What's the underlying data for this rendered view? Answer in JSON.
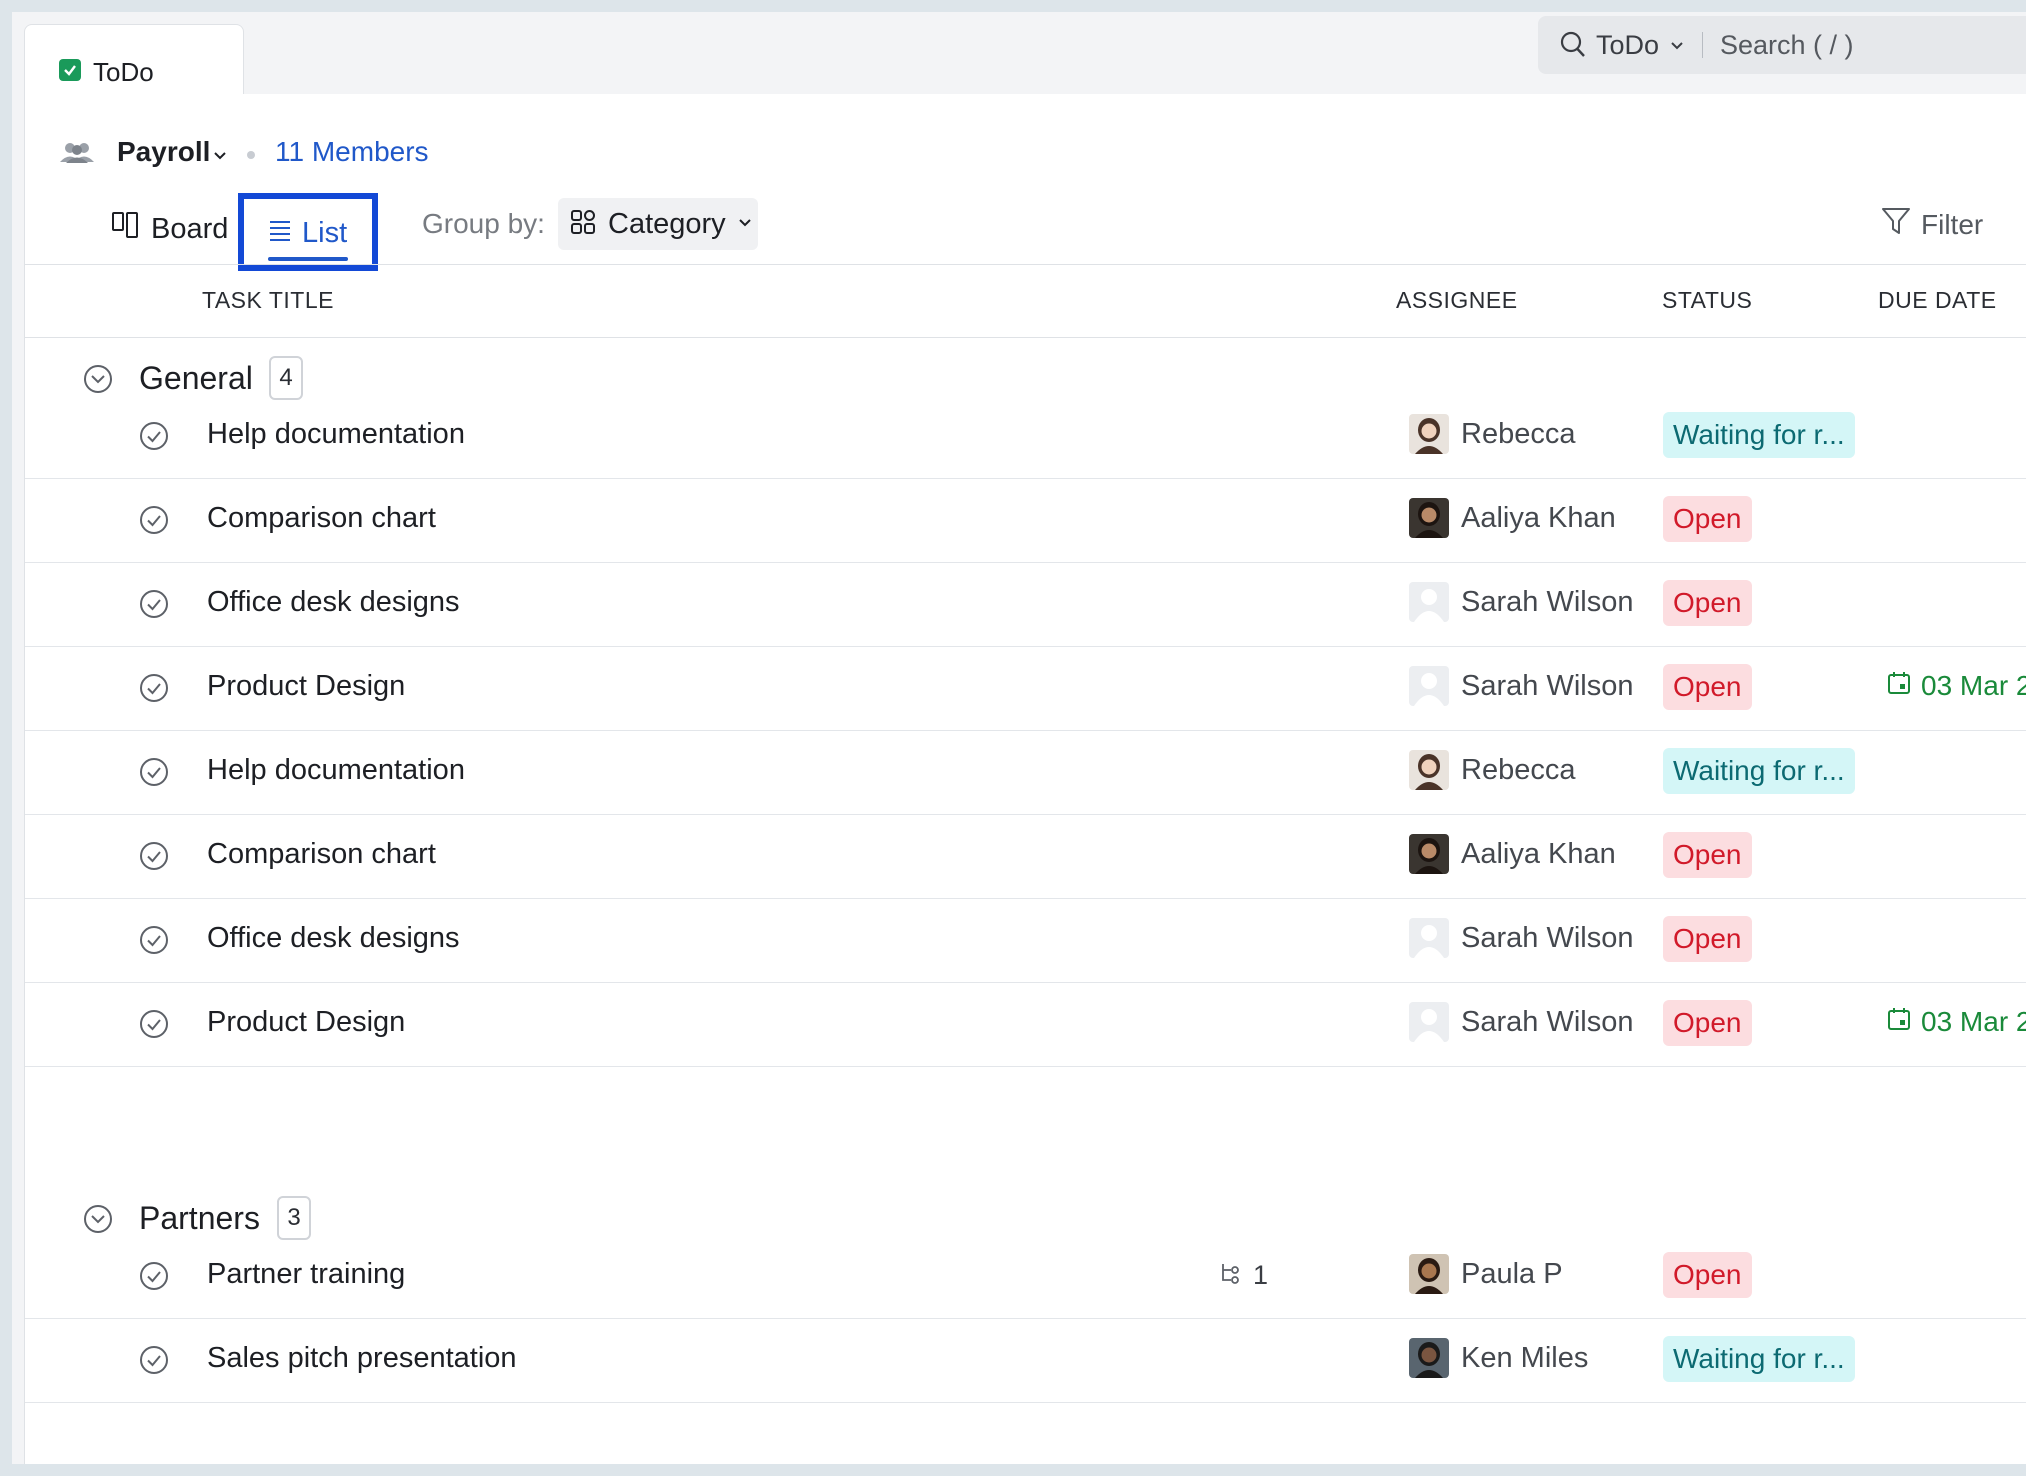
{
  "tab": {
    "label": "ToDo"
  },
  "search": {
    "scope": "ToDo",
    "placeholder": "Search ( / )"
  },
  "header": {
    "team": "Payroll",
    "members": "11 Members"
  },
  "views": {
    "board": "Board",
    "list": "List"
  },
  "groupby": {
    "label": "Group by:",
    "value": "Category"
  },
  "filter": {
    "label": "Filter"
  },
  "columns": {
    "title": "TASK TITLE",
    "assignee": "ASSIGNEE",
    "status": "STATUS",
    "due": "DUE DATE"
  },
  "colors": {
    "accent": "#2058c9",
    "open_bg": "#fcdde0",
    "open_fg": "#d11a2a",
    "waiting_bg": "#d4f6f7",
    "waiting_fg": "#0c6a72",
    "due": "#1a8a3a"
  },
  "groups": [
    {
      "name": "General",
      "count": "4",
      "rows": [
        {
          "title": "Help documentation",
          "assignee": "Rebecca",
          "avatar": "photo-light",
          "status": "Waiting for r...",
          "status_type": "waiting",
          "due": ""
        },
        {
          "title": "Comparison chart",
          "assignee": "Aaliya Khan",
          "avatar": "photo-dark",
          "status": "Open",
          "status_type": "open",
          "due": ""
        },
        {
          "title": "Office desk designs",
          "assignee": "Sarah Wilson",
          "avatar": "placeholder",
          "status": "Open",
          "status_type": "open",
          "due": ""
        },
        {
          "title": "Product Design",
          "assignee": "Sarah Wilson",
          "avatar": "placeholder",
          "status": "Open",
          "status_type": "open",
          "due": "03 Mar 2"
        },
        {
          "title": "Help documentation",
          "assignee": "Rebecca",
          "avatar": "photo-light",
          "status": "Waiting for r...",
          "status_type": "waiting",
          "due": ""
        },
        {
          "title": "Comparison chart",
          "assignee": "Aaliya Khan",
          "avatar": "photo-dark",
          "status": "Open",
          "status_type": "open",
          "due": ""
        },
        {
          "title": "Office desk designs",
          "assignee": "Sarah Wilson",
          "avatar": "placeholder",
          "status": "Open",
          "status_type": "open",
          "due": ""
        },
        {
          "title": "Product Design",
          "assignee": "Sarah Wilson",
          "avatar": "placeholder",
          "status": "Open",
          "status_type": "open",
          "due": "03 Mar 2"
        }
      ]
    },
    {
      "name": "Partners",
      "count": "3",
      "rows": [
        {
          "title": "Partner training",
          "subtasks": "1",
          "assignee": "Paula P",
          "avatar": "photo-curly",
          "status": "Open",
          "status_type": "open",
          "due": ""
        },
        {
          "title": "Sales pitch presentation",
          "assignee": "Ken Miles",
          "avatar": "photo-cap",
          "status": "Waiting for r...",
          "status_type": "waiting",
          "due": ""
        },
        {
          "title": "",
          "assignee": "",
          "avatar": "",
          "status": "",
          "status_type": "open",
          "due": ""
        }
      ]
    }
  ]
}
